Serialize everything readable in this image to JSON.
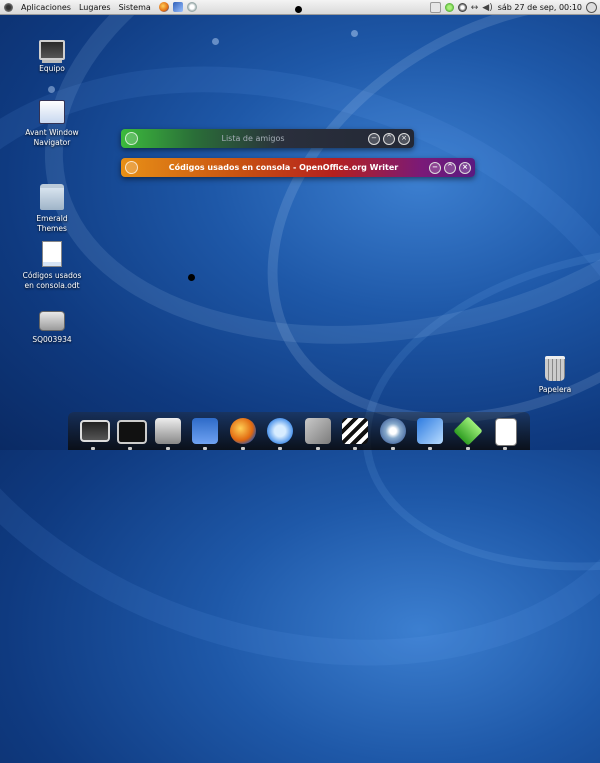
{
  "top_panel": {
    "menus": [
      "Aplicaciones",
      "Lugares",
      "Sistema"
    ],
    "clock": "sáb 27 de sep, 00:10"
  },
  "desktop_icons": [
    {
      "label": "Equipo",
      "icon": "computer-icon"
    },
    {
      "label": "Avant Window Navigator",
      "icon": "avant-window-navigator-icon"
    },
    {
      "label": "Emerald Themes",
      "icon": "folder-icon"
    },
    {
      "label": "Códigos usados en consola.odt",
      "icon": "document-icon"
    },
    {
      "label": "SQ003934",
      "icon": "drive-icon"
    },
    {
      "label": "Papelera",
      "icon": "trash-icon"
    }
  ],
  "windows": [
    {
      "title": "Lista de amigos",
      "accent": "#3cbb3c"
    },
    {
      "title": "Códigos usados en consola - OpenOffice.org Writer",
      "accent": "#e89016"
    }
  ],
  "dock_items": [
    "computer-icon",
    "terminal-icon",
    "printer-icon",
    "save-icon",
    "firefox-icon",
    "chat-icon",
    "tools-icon",
    "clapperboard-icon",
    "cd-icon",
    "cursor-icon",
    "gem-icon",
    "document-icon"
  ]
}
